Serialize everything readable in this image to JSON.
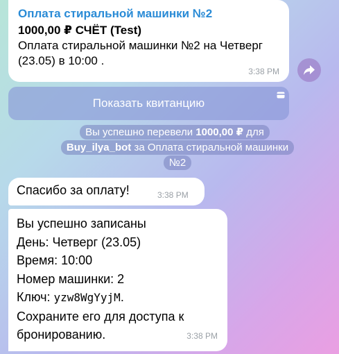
{
  "invoice": {
    "title": "Оплата стиральной машинки №2",
    "amount_line": "1000,00 ₽ СЧЁТ (Test)",
    "description": "Оплата стиральной машинки №2 на Четверг (23.05) в 10:00 .",
    "time": "3:38 PM"
  },
  "share_button": {
    "icon": "share-arrow-icon"
  },
  "receipt_button": {
    "label": "Показать квитанцию",
    "icon": "card-icon"
  },
  "service_message": {
    "prefix": "Вы успешно перевели ",
    "amount": "1000,00 ₽",
    "middle": " для ",
    "bot": "Buy_ilya_bot",
    "suffix": " за Оплата стиральной машинки №2"
  },
  "thanks_message": {
    "text": "Спасибо за оплату!",
    "time": "3:38 PM"
  },
  "confirmation": {
    "line1": "Вы успешно записаны",
    "line2": "День: Четверг (23.05)",
    "line3": "Время: 10:00",
    "line4": "Номер машинки: 2",
    "key_label": "Ключ: ",
    "key_value": "yzw8WgYyjM",
    "key_suffix": ".",
    "line6": "Сохраните его для доступа к бронированию.",
    "time": "3:38 PM"
  },
  "colors": {
    "link_blue": "#2a8bd6",
    "bubble_bg": "#ffffff",
    "time_gray": "#9aa0a6"
  }
}
